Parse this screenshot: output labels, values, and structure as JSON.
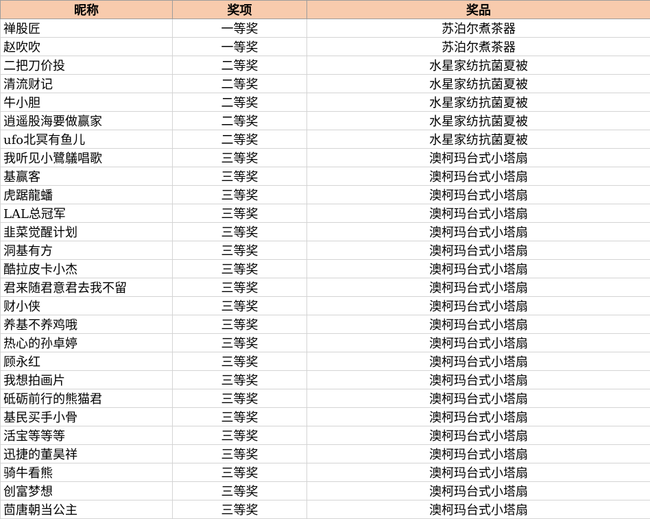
{
  "headers": [
    "昵称",
    "奖项",
    "奖品"
  ],
  "rows": [
    [
      "禅股匠",
      "一等奖",
      "苏泊尔煮茶器"
    ],
    [
      "赵吹吹",
      "一等奖",
      "苏泊尔煮茶器"
    ],
    [
      "二把刀价投",
      "二等奖",
      "水星家纺抗菌夏被"
    ],
    [
      "清流财记",
      "二等奖",
      "水星家纺抗菌夏被"
    ],
    [
      "牛小胆",
      "二等奖",
      "水星家纺抗菌夏被"
    ],
    [
      "逍遥股海要做赢家",
      "二等奖",
      "水星家纺抗菌夏被"
    ],
    [
      "ufo北冥有鱼儿",
      "二等奖",
      "水星家纺抗菌夏被"
    ],
    [
      "我听见小鷺鸃唱歌",
      "三等奖",
      "澳柯玛台式小塔扇"
    ],
    [
      "基赢客",
      "三等奖",
      "澳柯玛台式小塔扇"
    ],
    [
      "虎踞龍蟠",
      "三等奖",
      "澳柯玛台式小塔扇"
    ],
    [
      "LAL总冠军",
      "三等奖",
      "澳柯玛台式小塔扇"
    ],
    [
      "韭菜觉醒计划",
      "三等奖",
      "澳柯玛台式小塔扇"
    ],
    [
      "洞基有方",
      "三等奖",
      "澳柯玛台式小塔扇"
    ],
    [
      "酷拉皮卡小杰",
      "三等奖",
      "澳柯玛台式小塔扇"
    ],
    [
      "君来随君意君去我不留",
      "三等奖",
      "澳柯玛台式小塔扇"
    ],
    [
      "财小侠",
      "三等奖",
      "澳柯玛台式小塔扇"
    ],
    [
      "养基不养鸡哦",
      "三等奖",
      "澳柯玛台式小塔扇"
    ],
    [
      "热心的孙卓婷",
      "三等奖",
      "澳柯玛台式小塔扇"
    ],
    [
      "顾永红",
      "三等奖",
      "澳柯玛台式小塔扇"
    ],
    [
      "我想拍画片",
      "三等奖",
      "澳柯玛台式小塔扇"
    ],
    [
      "砥砺前行的熊猫君",
      "三等奖",
      "澳柯玛台式小塔扇"
    ],
    [
      "基民买手小骨",
      "三等奖",
      "澳柯玛台式小塔扇"
    ],
    [
      "活宝等等等",
      "三等奖",
      "澳柯玛台式小塔扇"
    ],
    [
      "迅捷的董昊祥",
      "三等奖",
      "澳柯玛台式小塔扇"
    ],
    [
      "骑牛看熊",
      "三等奖",
      "澳柯玛台式小塔扇"
    ],
    [
      "创富梦想",
      "三等奖",
      "澳柯玛台式小塔扇"
    ],
    [
      "茴唐朝当公主",
      "三等奖",
      "澳柯玛台式小塔扇"
    ]
  ],
  "colors": {
    "header_bg": "#f8cbad",
    "grid": "#d4d4d4"
  }
}
